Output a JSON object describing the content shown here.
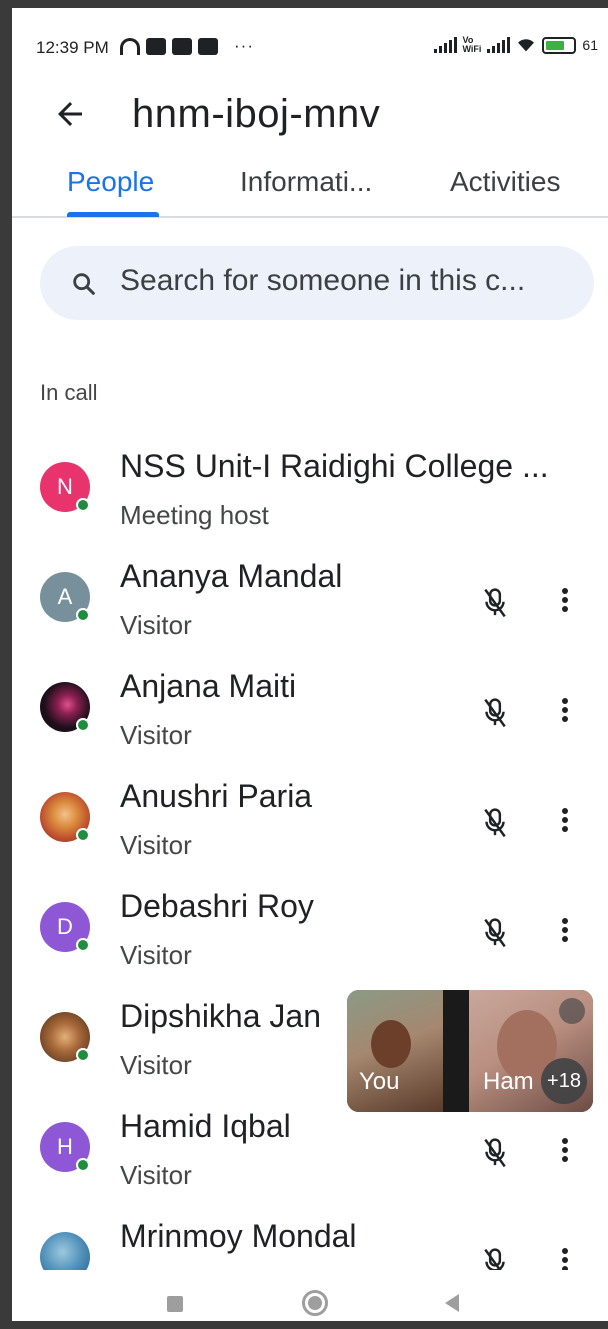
{
  "status_bar": {
    "time": "12:39 PM",
    "more": "···",
    "volte": "Vo\nWiFi",
    "battery": "61"
  },
  "header": {
    "title": "hnm-iboj-mnv"
  },
  "tabs": [
    {
      "label": "People",
      "active": true
    },
    {
      "label": "Informati...",
      "active": false
    },
    {
      "label": "Activities",
      "active": false
    }
  ],
  "search": {
    "placeholder": "Search for someone in this c..."
  },
  "section": {
    "label": "In call"
  },
  "participants": [
    {
      "name": "NSS Unit-I Raidighi College ...",
      "role": "Meeting host",
      "initial": "N",
      "avatar_color": "#e8336d",
      "muted": false
    },
    {
      "name": "Ananya Mandal",
      "role": "Visitor",
      "initial": "A",
      "avatar_color": "#78909c",
      "muted": true
    },
    {
      "name": "Anjana Maiti",
      "role": "Visitor",
      "initial": "",
      "avatar_color": "#1c0f1a",
      "muted": true
    },
    {
      "name": "Anushri Paria",
      "role": "Visitor",
      "initial": "",
      "avatar_color": "#c98a4a",
      "muted": true
    },
    {
      "name": "Debashri Roy",
      "role": "Visitor",
      "initial": "D",
      "avatar_color": "#8e57d6",
      "muted": true
    },
    {
      "name": "Dipshikha Jan",
      "role": "Visitor",
      "initial": "",
      "avatar_color": "#7a4b2c",
      "muted": true
    },
    {
      "name": "Hamid Iqbal",
      "role": "Visitor",
      "initial": "H",
      "avatar_color": "#8e57d6",
      "muted": true
    },
    {
      "name": "Mrinmoy Mondal",
      "role": "",
      "initial": "",
      "avatar_color": "#4f8fb8",
      "muted": true
    }
  ],
  "pip": {
    "self_label": "You",
    "other_label": "Ham",
    "more_count": "+18"
  },
  "colors": {
    "accent": "#1a73e8",
    "online": "#1e8e3e"
  }
}
